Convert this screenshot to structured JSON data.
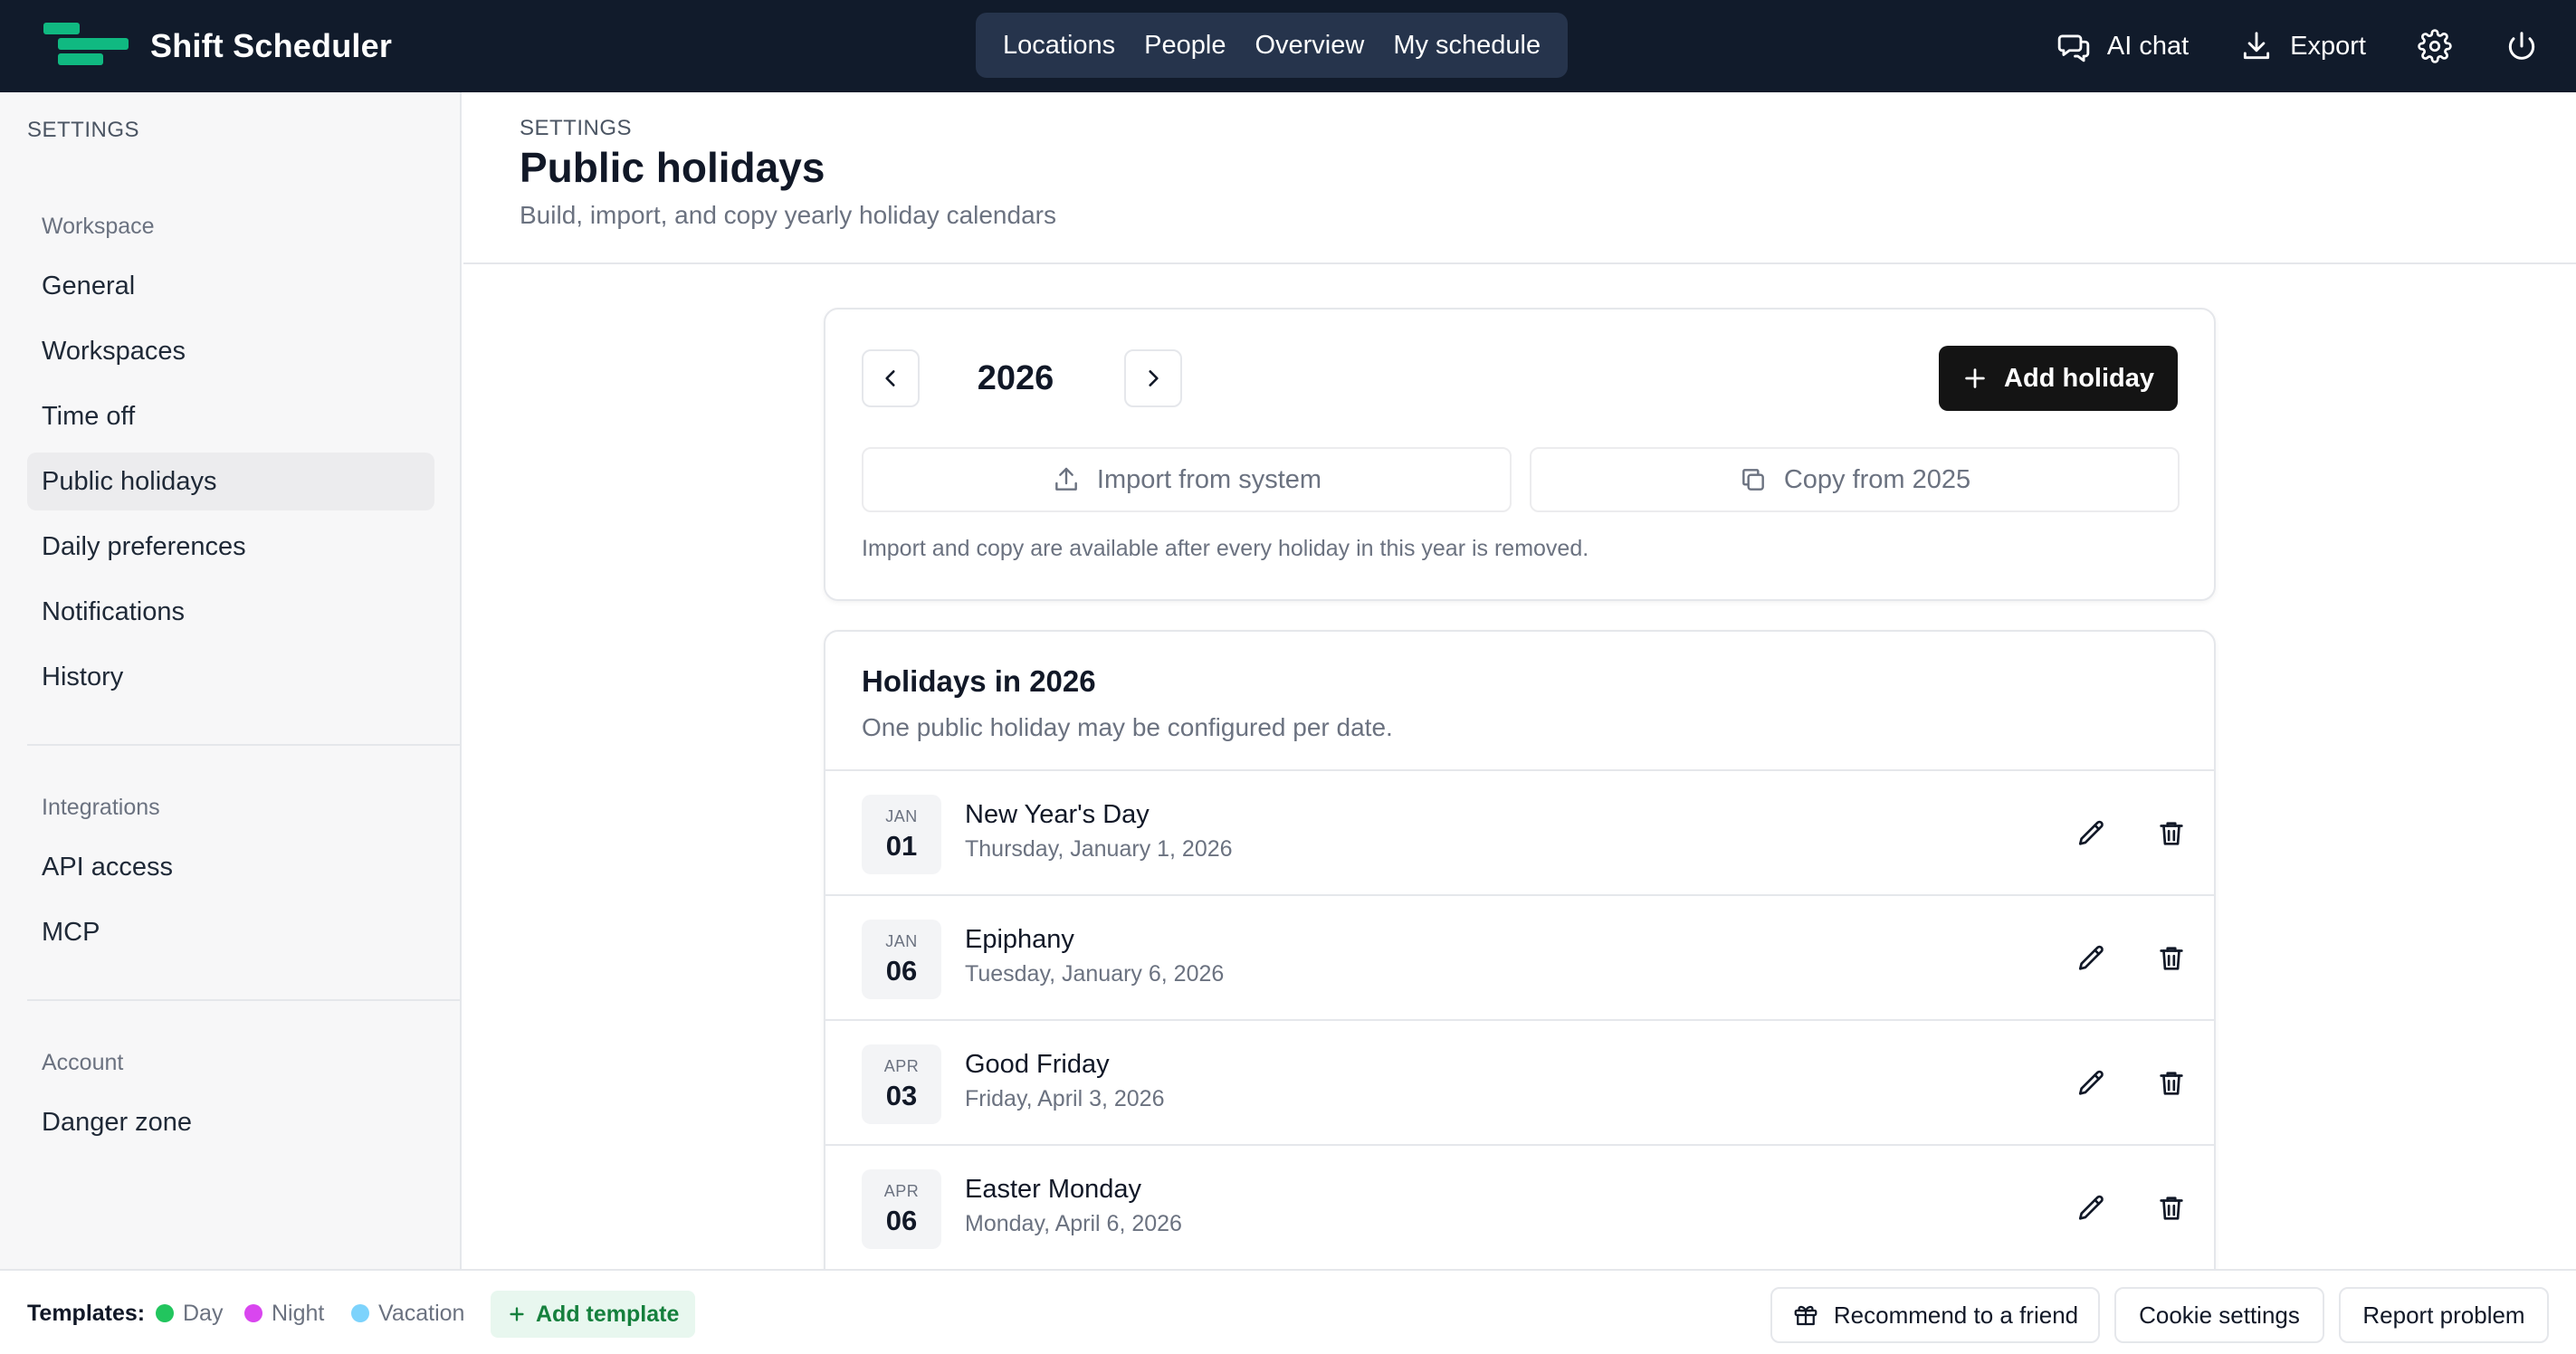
{
  "app": {
    "title": "Shift Scheduler",
    "accent_color": "#10b981",
    "topbar_color": "#111b2b"
  },
  "nav": {
    "items": [
      "Locations",
      "People",
      "Overview",
      "My schedule"
    ]
  },
  "top_actions": {
    "ai_chat": "AI chat",
    "export": "Export",
    "settings_icon": "gear-icon",
    "power_icon": "power-icon"
  },
  "sidebar": {
    "heading": "SETTINGS",
    "sections": [
      {
        "title": "Workspace",
        "items": [
          "General",
          "Workspaces",
          "Time off",
          "Public holidays",
          "Daily preferences",
          "Notifications",
          "History"
        ]
      },
      {
        "title": "Integrations",
        "items": [
          "API access",
          "MCP"
        ]
      },
      {
        "title": "Account",
        "items": [
          "Danger zone"
        ]
      }
    ],
    "active_item": "Public holidays"
  },
  "page": {
    "breadcrumb": "SETTINGS",
    "title": "Public holidays",
    "subtitle": "Build, import, and copy yearly holiday calendars"
  },
  "year_card": {
    "year": "2026",
    "add_label": "Add holiday",
    "import_label": "Import from system",
    "copy_label": "Copy from 2025",
    "note": "Import and copy are available after every holiday in this year is removed."
  },
  "holidays": {
    "title": "Holidays in 2026",
    "subtitle": "One public holiday may be configured per date.",
    "rows": [
      {
        "month": "JAN",
        "day": "01",
        "name": "New Year's Day",
        "date": "Thursday, January 1, 2026"
      },
      {
        "month": "JAN",
        "day": "06",
        "name": "Epiphany",
        "date": "Tuesday, January 6, 2026"
      },
      {
        "month": "APR",
        "day": "03",
        "name": "Good Friday",
        "date": "Friday, April 3, 2026"
      },
      {
        "month": "APR",
        "day": "06",
        "name": "Easter Monday",
        "date": "Monday, April 6, 2026"
      }
    ]
  },
  "footer": {
    "templates_label": "Templates:",
    "templates": [
      {
        "name": "Day",
        "color": "#22c55e"
      },
      {
        "name": "Night",
        "color": "#d946ef"
      },
      {
        "name": "Vacation",
        "color": "#7dd3fc"
      }
    ],
    "add_template": "Add template",
    "recommend": "Recommend to a friend",
    "cookie": "Cookie settings",
    "report": "Report problem"
  }
}
